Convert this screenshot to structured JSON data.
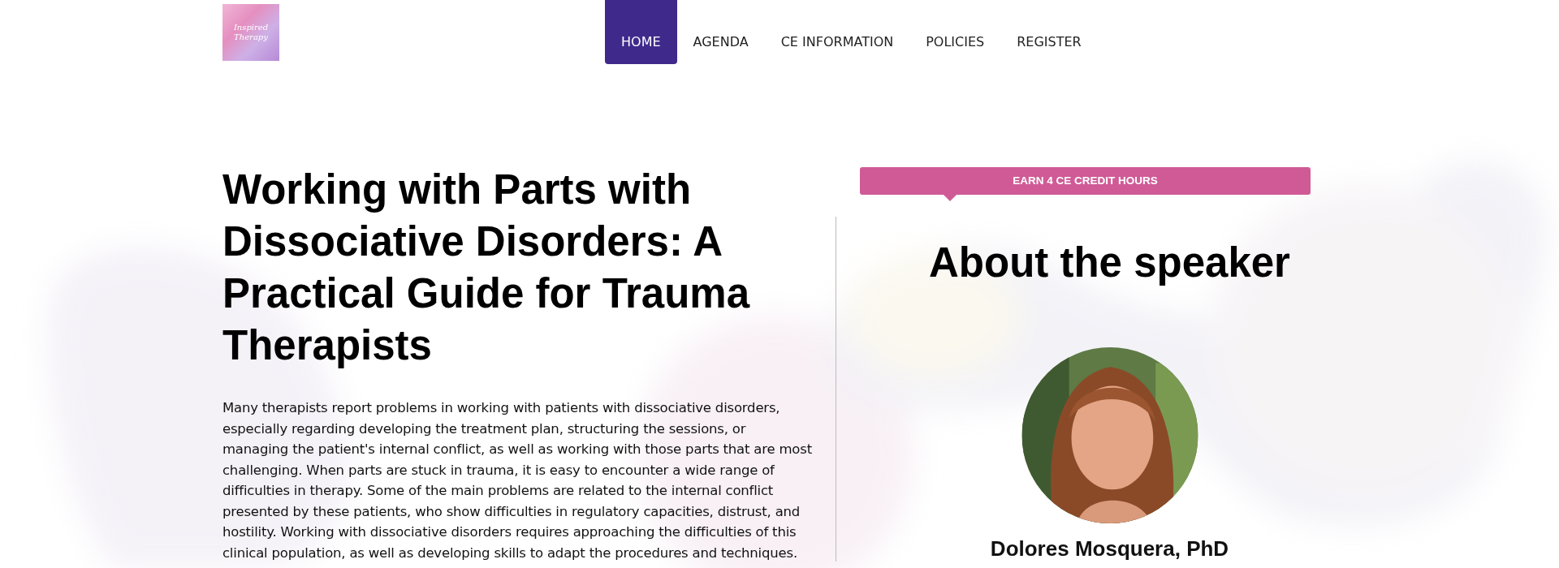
{
  "logo": {
    "text": "Inspired Therapy"
  },
  "nav": [
    {
      "label": "HOME",
      "selected": true
    },
    {
      "label": "AGENDA",
      "selected": false
    },
    {
      "label": "CE INFORMATION",
      "selected": false
    },
    {
      "label": "POLICIES",
      "selected": false
    },
    {
      "label": "REGISTER",
      "selected": false
    }
  ],
  "intro": {
    "title": "Working with Parts with Dissociative Disorders: A Practical Guide for Trauma Therapists",
    "description": "Many therapists report problems in working with patients with dissociative disorders, especially regarding developing the treatment plan, structuring the sessions, or managing the patient's internal conflict, as well as working with those parts that are most challenging. When parts are stuck in trauma, it is easy to encounter a wide range of difficulties in therapy. Some of the main problems are related to the internal conflict presented by these patients, who show difficulties in regulatory capacities, distrust, and hostility. Working with dissociative disorders requires approaching the difficulties of this clinical population, as well as developing skills to adapt the procedures and techniques."
  },
  "speaker": {
    "banner": "EARN 4 CE CREDIT HOURS",
    "heading": "About the speaker",
    "name": "Dolores Mosquera, PhD"
  }
}
